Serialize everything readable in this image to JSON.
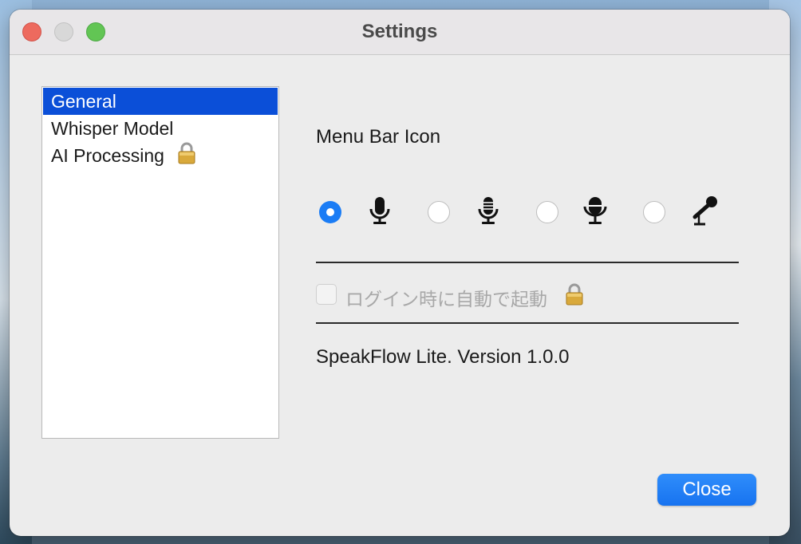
{
  "window": {
    "title": "Settings"
  },
  "sidebar": {
    "items": [
      {
        "label": "General",
        "selected": true
      },
      {
        "label": "Whisper Model",
        "selected": false
      },
      {
        "label": "AI Processing",
        "selected": false,
        "icon": "lock-icon"
      }
    ]
  },
  "general": {
    "menu_bar_icon_label": "Menu Bar Icon",
    "icon_options": [
      {
        "icon": "microphone-icon",
        "checked": true
      },
      {
        "icon": "microphone-grille-icon",
        "checked": false
      },
      {
        "icon": "podcast-microphone-icon",
        "checked": false
      },
      {
        "icon": "handheld-microphone-icon",
        "checked": false
      }
    ],
    "launch_at_login_label": "ログイン時に自動で起動",
    "launch_at_login_checked": false,
    "launch_at_login_disabled": true,
    "version_text": "SpeakFlow Lite. Version 1.0.0"
  },
  "footer": {
    "close_label": "Close"
  },
  "colors": {
    "accent": "#1a7cf5",
    "selection": "#0b4fd8",
    "window_bg": "#ececec"
  }
}
